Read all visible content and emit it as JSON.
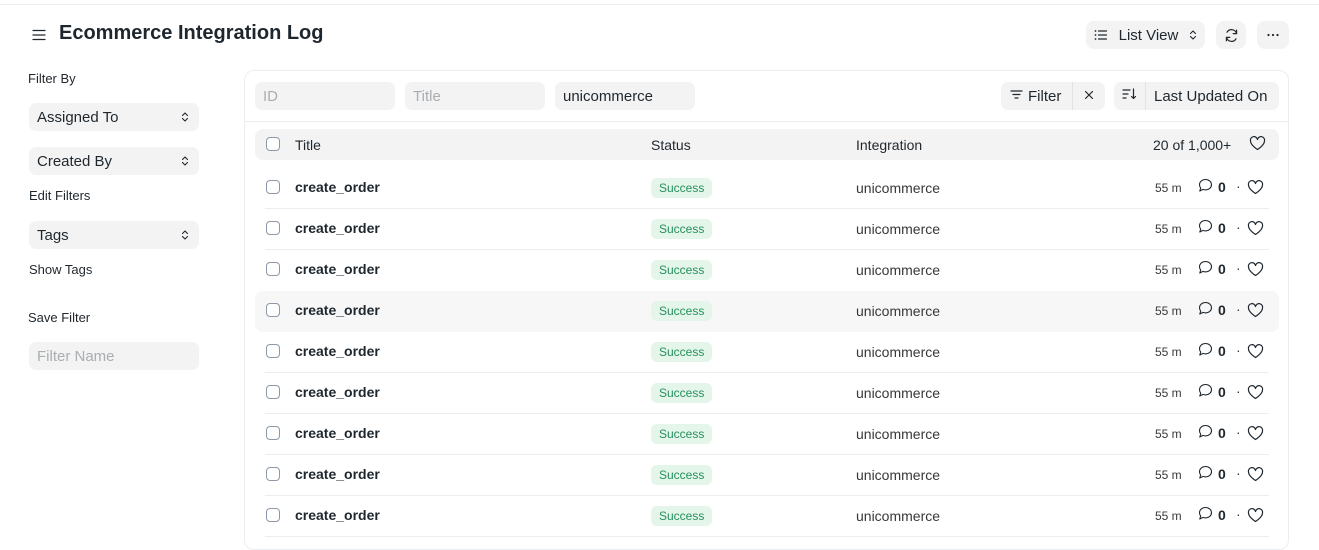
{
  "header": {
    "title": "Ecommerce Integration Log",
    "list_view_label": "List View"
  },
  "sidebar": {
    "filter_by_label": "Filter By",
    "assigned_to": "Assigned To",
    "created_by": "Created By",
    "edit_filters": "Edit Filters",
    "tags": "Tags",
    "show_tags": "Show Tags",
    "save_filter": "Save Filter",
    "filter_name_placeholder": "Filter Name"
  },
  "filters": {
    "id_placeholder": "ID",
    "title_placeholder": "Title",
    "integration_value": "unicommerce",
    "filter_label": "Filter",
    "sort_label": "Last Updated On"
  },
  "list": {
    "columns": {
      "title": "Title",
      "status": "Status",
      "integration": "Integration"
    },
    "count_label": "20 of 1,000+",
    "rows": [
      {
        "title": "create_order",
        "status": "Success",
        "integration": "unicommerce",
        "time": "55 m",
        "comments": "0"
      },
      {
        "title": "create_order",
        "status": "Success",
        "integration": "unicommerce",
        "time": "55 m",
        "comments": "0"
      },
      {
        "title": "create_order",
        "status": "Success",
        "integration": "unicommerce",
        "time": "55 m",
        "comments": "0"
      },
      {
        "title": "create_order",
        "status": "Success",
        "integration": "unicommerce",
        "time": "55 m",
        "comments": "0"
      },
      {
        "title": "create_order",
        "status": "Success",
        "integration": "unicommerce",
        "time": "55 m",
        "comments": "0"
      },
      {
        "title": "create_order",
        "status": "Success",
        "integration": "unicommerce",
        "time": "55 m",
        "comments": "0"
      },
      {
        "title": "create_order",
        "status": "Success",
        "integration": "unicommerce",
        "time": "55 m",
        "comments": "0"
      },
      {
        "title": "create_order",
        "status": "Success",
        "integration": "unicommerce",
        "time": "55 m",
        "comments": "0"
      },
      {
        "title": "create_order",
        "status": "Success",
        "integration": "unicommerce",
        "time": "55 m",
        "comments": "0"
      }
    ]
  },
  "colors": {
    "success_bg": "#e4f5e9",
    "success_text": "#278f5e",
    "control_bg": "#f3f3f3",
    "border": "#ebeef0"
  },
  "icons": [
    "menu-icon",
    "list-icon",
    "updown-icon",
    "refresh-icon",
    "more-icon",
    "filter-icon",
    "close-icon",
    "sort-icon",
    "heart-icon",
    "comment-icon"
  ]
}
